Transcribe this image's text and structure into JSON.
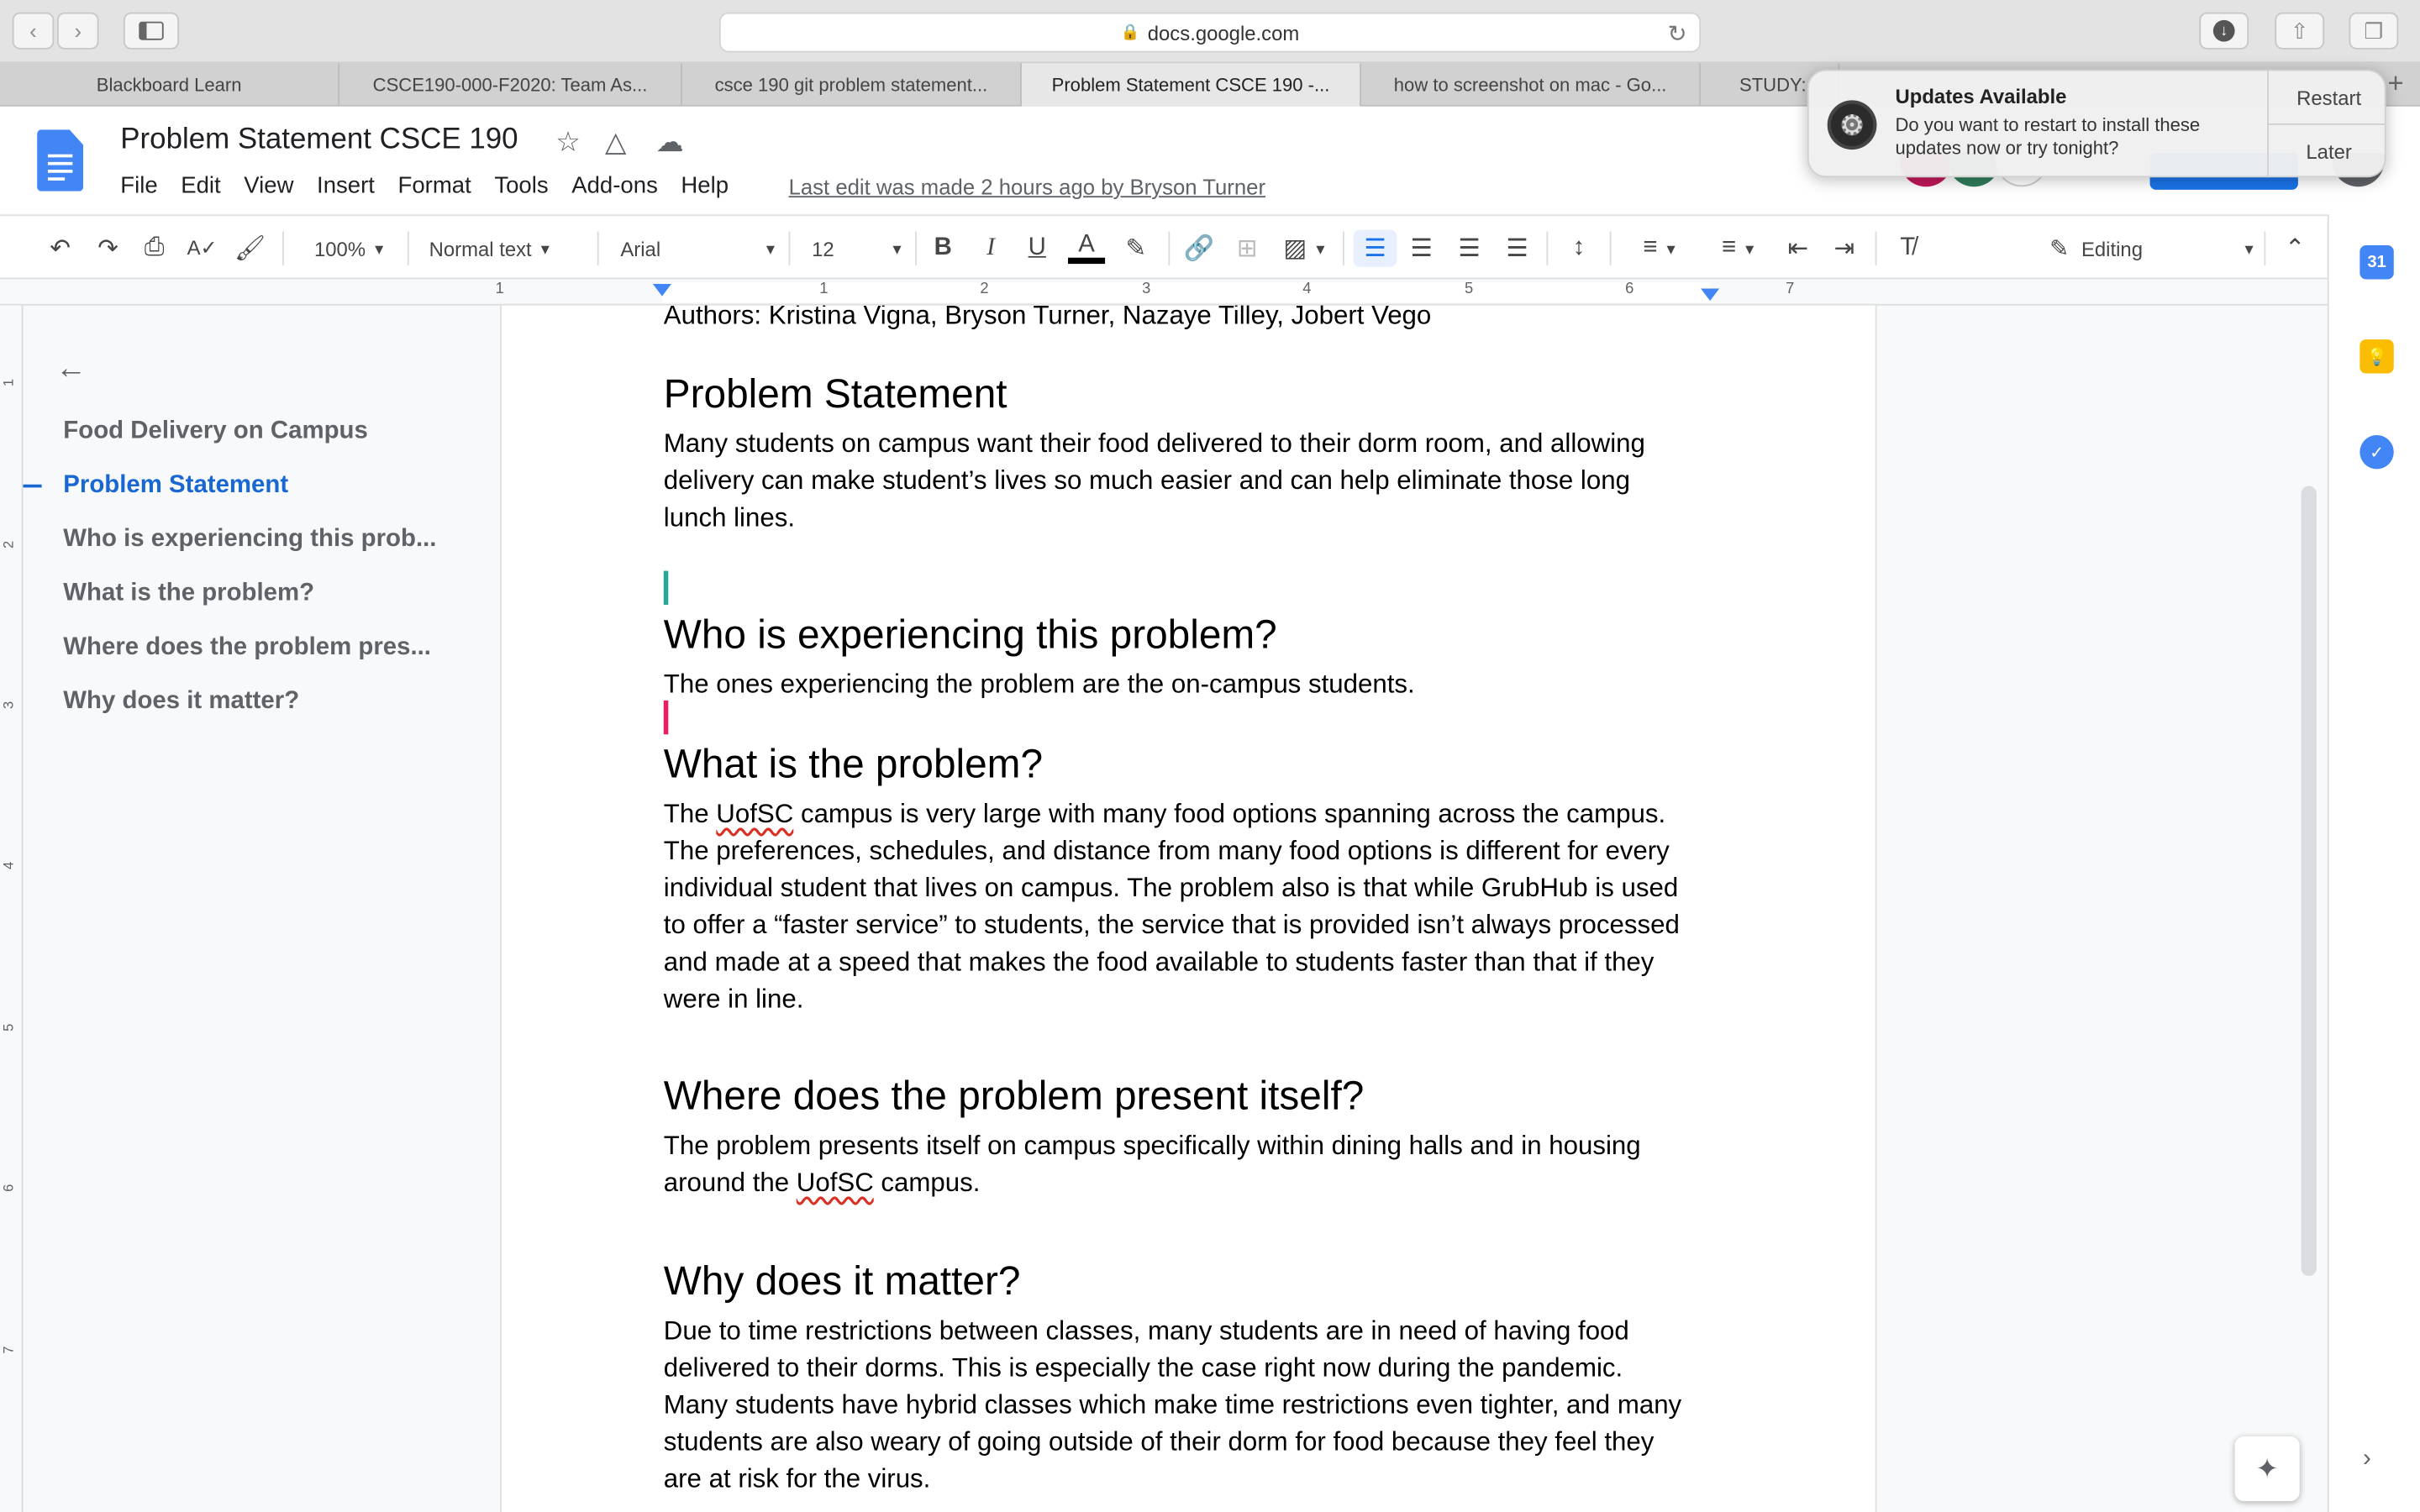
{
  "browser": {
    "url": "docs.google.com",
    "tabs": [
      {
        "label": "Blackboard Learn"
      },
      {
        "label": "CSCE190-000-F2020: Team As..."
      },
      {
        "label": "csce 190 git problem statement..."
      },
      {
        "label": "Problem Statement CSCE 190 -..."
      },
      {
        "label": "how to screenshot on mac - Go..."
      },
      {
        "label": "STUDY:"
      }
    ]
  },
  "notification": {
    "title": "Updates Available",
    "body": "Do you want to restart to install these updates now or try tonight?",
    "restart_label": "Restart",
    "later_label": "Later"
  },
  "docs": {
    "title": "Problem Statement CSCE 190",
    "menu": [
      "File",
      "Edit",
      "View",
      "Insert",
      "Format",
      "Tools",
      "Add-ons",
      "Help"
    ],
    "last_edit": "Last edit was made 2 hours ago by Bryson Turner"
  },
  "toolbar": {
    "zoom": "100%",
    "style": "Normal text",
    "font": "Arial",
    "size": "12",
    "mode": "Editing"
  },
  "ruler": {
    "numbers": [
      "1",
      "1",
      "2",
      "3",
      "4",
      "5",
      "6",
      "7"
    ],
    "v_numbers": [
      "1",
      "2",
      "3",
      "4",
      "5",
      "6",
      "7"
    ]
  },
  "outline": {
    "items": [
      {
        "label": "Food Delivery on Campus"
      },
      {
        "label": "Problem Statement"
      },
      {
        "label": "Who is experiencing this prob..."
      },
      {
        "label": "What is the problem?"
      },
      {
        "label": "Where does the problem pres..."
      },
      {
        "label": "Why does it matter?"
      }
    ]
  },
  "document": {
    "authors": "Authors: Kristina Vigna, Bryson Turner, Nazaye Tilley, Jobert Vego",
    "sections": [
      {
        "heading": "Problem Statement",
        "lines": [
          "Many students on campus want their food delivered to their dorm room, and allowing",
          "delivery can make student’s lives so much easier and can help eliminate those long",
          "lunch lines."
        ]
      },
      {
        "heading": "Who is experiencing this problem?",
        "lines": [
          "The ones experiencing the problem are the on-campus students."
        ]
      },
      {
        "heading": "What is the problem?",
        "line1_pre": "The ",
        "line1_word": "UofSC",
        "line1_post": " campus is very large with many food options spanning across the campus.",
        "lines": [
          "The preferences, schedules, and distance from many food options is different for every",
          "individual student that lives on campus. The problem also is that while GrubHub is used",
          "to offer a “faster service” to students, the service that is provided isn’t always processed",
          "and made at a speed that makes the food available to students faster than that if they",
          "were in line."
        ]
      },
      {
        "heading": "Where does the problem present itself?",
        "lines": [
          "The problem presents itself on campus specifically within dining halls and in housing"
        ],
        "line2_pre": "around the ",
        "line2_word": "UofSC",
        "line2_post": " campus."
      },
      {
        "heading": "Why does it matter?",
        "lines": [
          "Due to time restrictions between classes, many students are in need of having food",
          "delivered to their dorms. This is especially the case right now during the pandemic.",
          "Many students have hybrid classes which make time restrictions even tighter, and many",
          "students are also weary of going outside of their dorm for food because they feel they",
          "are at risk for the virus."
        ]
      }
    ]
  },
  "sidebar_icons": {
    "calendar": "31"
  }
}
